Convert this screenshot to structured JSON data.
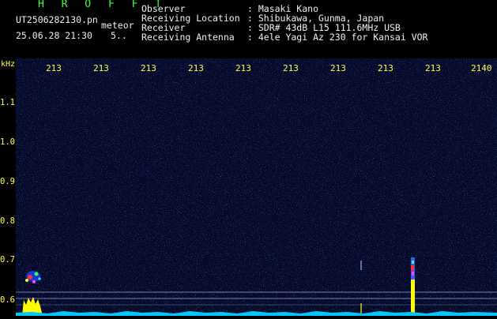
{
  "header": {
    "brand": "H R O F F T",
    "file_name": "UT2506282130.pn",
    "tag": "meteor",
    "date_time": "25.06.28 21:30",
    "count": "5..",
    "info": [
      {
        "label": "Observer",
        "value": ": Masaki Kano"
      },
      {
        "label": "Receiving Location",
        "value": ": Shibukawa, Gunma, Japan"
      },
      {
        "label": "Receiver",
        "value": ": SDR# 43dB L15 111.6MHz USB"
      },
      {
        "label": "Receiving Antenna",
        "value": ": 4ele Yagi Az 230 for Kansai VOR"
      }
    ]
  },
  "axis": {
    "unit": "kHz",
    "y_ticks": [
      "1.1",
      "1.0",
      "0.9",
      "0.8",
      "0.7",
      "0.6"
    ],
    "x_ticks": [
      "213",
      "213",
      "213",
      "213",
      "213",
      "213",
      "213",
      "213",
      "213",
      "2140"
    ]
  },
  "colors": {
    "background": "#040a28",
    "text_header": "#3cff3c",
    "text_axis": "#ffff50",
    "signal_trace": "#00c8ff",
    "signal_peak": "#ffff00"
  }
}
